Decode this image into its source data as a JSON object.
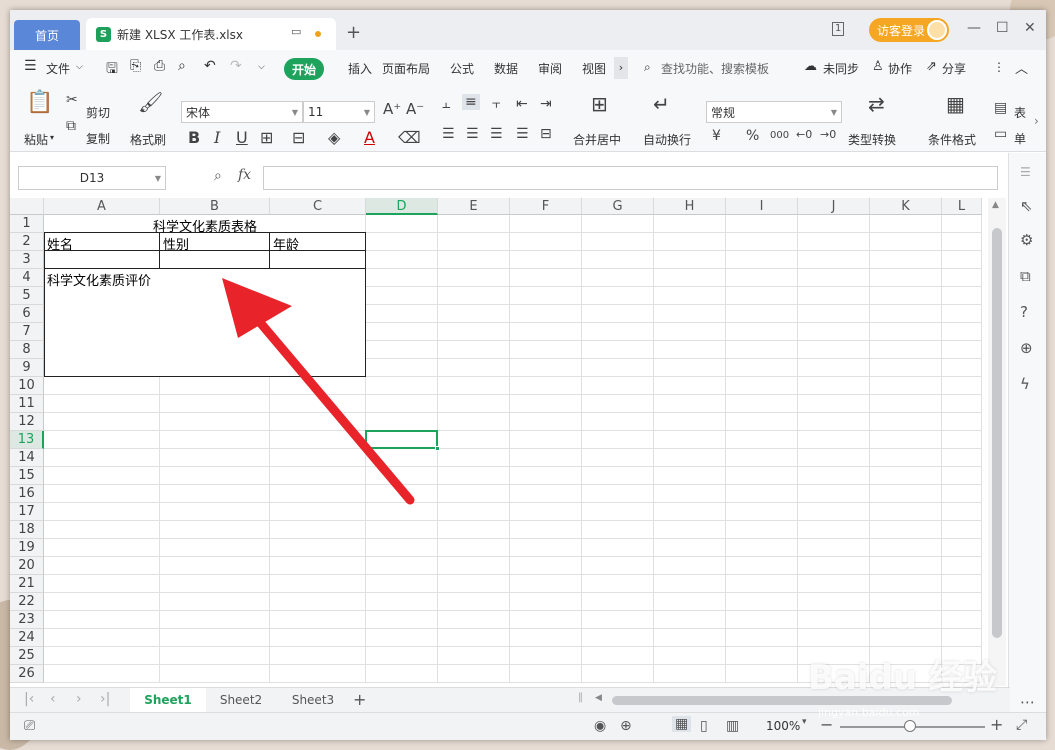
{
  "titlebar": {
    "home_tab": "首页",
    "file_tab": "新建 XLSX 工作表.xlsx",
    "file_icon_letter": "S",
    "new_tab": "+",
    "login_label": "访客登录",
    "page_count": "1",
    "min": "—",
    "max": "☐",
    "close": "✕"
  },
  "menubar": {
    "file": "文件",
    "start": "开始",
    "insert": "插入",
    "page_layout": "页面布局",
    "formula": "公式",
    "data": "数据",
    "review": "审阅",
    "view": "视图",
    "search_placeholder": "查找功能、搜索模板",
    "unsynced": "未同步",
    "collab": "协作",
    "share": "分享"
  },
  "ribbon": {
    "paste": "粘贴",
    "cut": "剪切",
    "copy": "复制",
    "format_painter": "格式刷",
    "font_name": "宋体",
    "font_size": "11",
    "merge_center": "合并居中",
    "wrap_text": "自动换行",
    "number_format": "常规",
    "type_convert": "类型转换",
    "cond_format": "条件格式",
    "table_style": "表",
    "cell": "单",
    "bold": "B",
    "italic": "I",
    "underline": "U",
    "percent": "%",
    "thousands": "000",
    "currency": "¥"
  },
  "formula_bar": {
    "name_box": "D13",
    "fx": "fx",
    "content": ""
  },
  "columns": [
    "A",
    "B",
    "C",
    "D",
    "E",
    "F",
    "G",
    "H",
    "I",
    "J",
    "K",
    "L"
  ],
  "rows": [
    "1",
    "2",
    "3",
    "4",
    "5",
    "6",
    "7",
    "8",
    "9",
    "10",
    "11",
    "12",
    "13",
    "14",
    "15",
    "16",
    "17",
    "18",
    "19",
    "20",
    "21",
    "22",
    "23",
    "24",
    "25",
    "26"
  ],
  "active_cell": "D13",
  "cells": {
    "title": "科学文化素质表格",
    "name": "姓名",
    "gender": "性别",
    "age": "年龄",
    "evaluation": "科学文化素质评价"
  },
  "sheets": [
    "Sheet1",
    "Sheet2",
    "Sheet3"
  ],
  "active_sheet": "Sheet1",
  "status": {
    "zoom": "100%"
  },
  "colors": {
    "accent_green": "#1da35c",
    "home_tab_blue": "#5b87d9",
    "login_orange": "#f5a623",
    "arrow_red": "#e8232a"
  },
  "watermark": {
    "main": "Baidu 经验",
    "sub": "jingyan.baidu.com"
  }
}
